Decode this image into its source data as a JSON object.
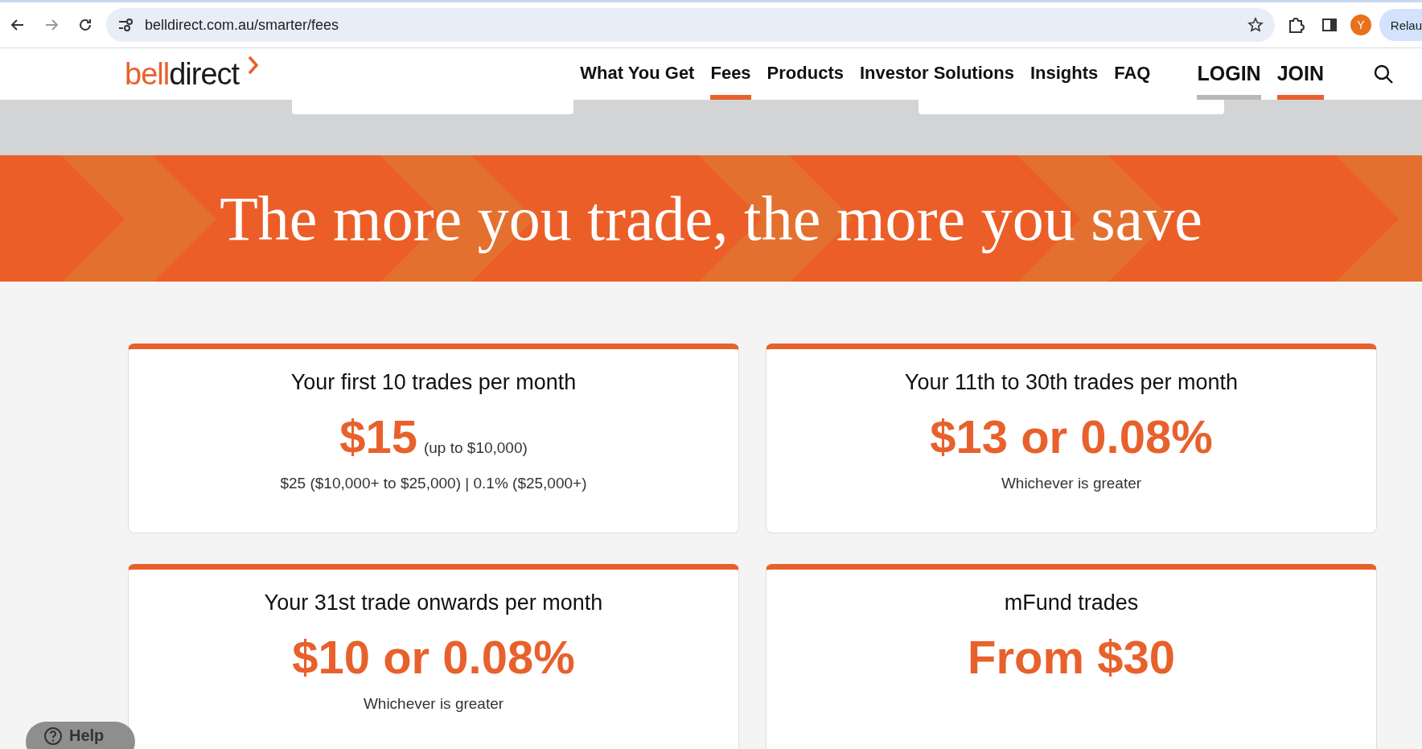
{
  "browser": {
    "url": "belldirect.com.au/smarter/fees",
    "profile_initial": "Y",
    "relaunch_label": "Relau"
  },
  "header": {
    "logo": {
      "part_1": "bell",
      "part_2": "direct"
    },
    "nav": [
      {
        "label": "What You Get",
        "selected": false
      },
      {
        "label": "Fees",
        "selected": true
      },
      {
        "label": "Products",
        "selected": false
      },
      {
        "label": "Investor Solutions",
        "selected": false
      },
      {
        "label": "Insights",
        "selected": false
      },
      {
        "label": "FAQ",
        "selected": false
      }
    ],
    "account_links": [
      {
        "label": "LOGIN",
        "color": "#b8b8b8"
      },
      {
        "label": "JOIN",
        "color": "#e8612c"
      }
    ]
  },
  "hero": {
    "title": "The more you trade, the more you save"
  },
  "fee_cards": [
    {
      "title": "Your first 10 trades per month",
      "price": "$15",
      "price_note": "(up to $10,000)",
      "detail": "$25 ($10,000+ to $25,000) | 0.1% ($25,000+)"
    },
    {
      "title": "Your 11th to 30th trades per month",
      "price": "$13 or 0.08%",
      "detail": "Whichever is greater"
    },
    {
      "title": "Your 31st trade onwards per month",
      "price": "$10 or 0.08%",
      "detail": "Whichever is greater"
    },
    {
      "title": "mFund trades",
      "price": "From $30"
    }
  ],
  "help_button": {
    "label": "Help"
  }
}
